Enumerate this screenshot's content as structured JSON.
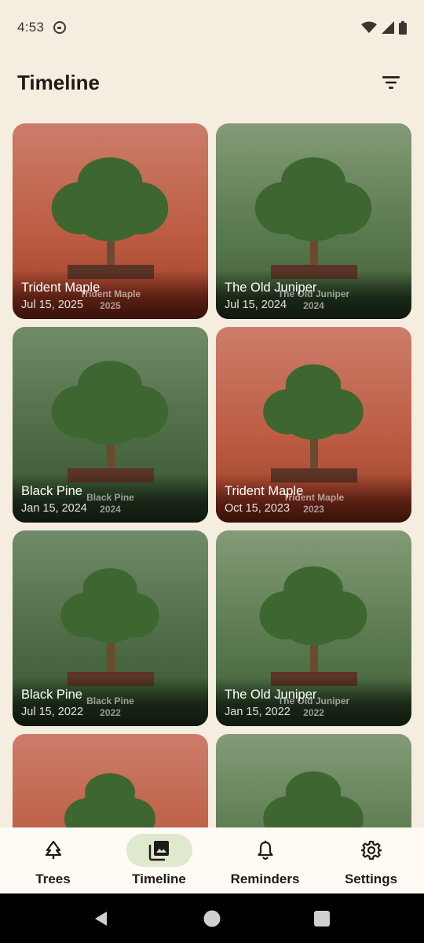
{
  "status_bar": {
    "time": "4:53"
  },
  "app_bar": {
    "title": "Timeline"
  },
  "cards": [
    {
      "name": "Trident Maple",
      "date": "Jul 15, 2025",
      "label_name": "Trident Maple",
      "label_year": "2025",
      "theme": "warm"
    },
    {
      "name": "The Old Juniper",
      "date": "Jul 15, 2024",
      "label_name": "The Old Juniper",
      "label_year": "2024",
      "theme": "green"
    },
    {
      "name": "Black Pine",
      "date": "Jan 15, 2024",
      "label_name": "Black Pine",
      "label_year": "2024",
      "theme": "green dark"
    },
    {
      "name": "Trident Maple",
      "date": "Oct 15, 2023",
      "label_name": "Trident Maple",
      "label_year": "2023",
      "theme": "warm"
    },
    {
      "name": "Black Pine",
      "date": "Jul 15, 2022",
      "label_name": "Black Pine",
      "label_year": "2022",
      "theme": "green dark"
    },
    {
      "name": "The Old Juniper",
      "date": "Jan 15, 2022",
      "label_name": "The Old Juniper",
      "label_year": "2022",
      "theme": "green"
    },
    {
      "name": "",
      "date": "",
      "label_name": "",
      "label_year": "",
      "theme": "warm"
    },
    {
      "name": "",
      "date": "",
      "label_name": "",
      "label_year": "",
      "theme": "green"
    }
  ],
  "bottom_nav": {
    "items": [
      {
        "label": "Trees",
        "icon": "tree-icon",
        "active": false
      },
      {
        "label": "Timeline",
        "icon": "photo-library-icon",
        "active": true
      },
      {
        "label": "Reminders",
        "icon": "bell-icon",
        "active": false
      },
      {
        "label": "Settings",
        "icon": "gear-icon",
        "active": false
      }
    ]
  },
  "colors": {
    "background": "#f5ede0",
    "nav_active_pill": "#dfe9cf",
    "tree_canopy": "#3d6631",
    "tree_trunk": "#6b4a32",
    "tree_pot": "#5a3426"
  }
}
